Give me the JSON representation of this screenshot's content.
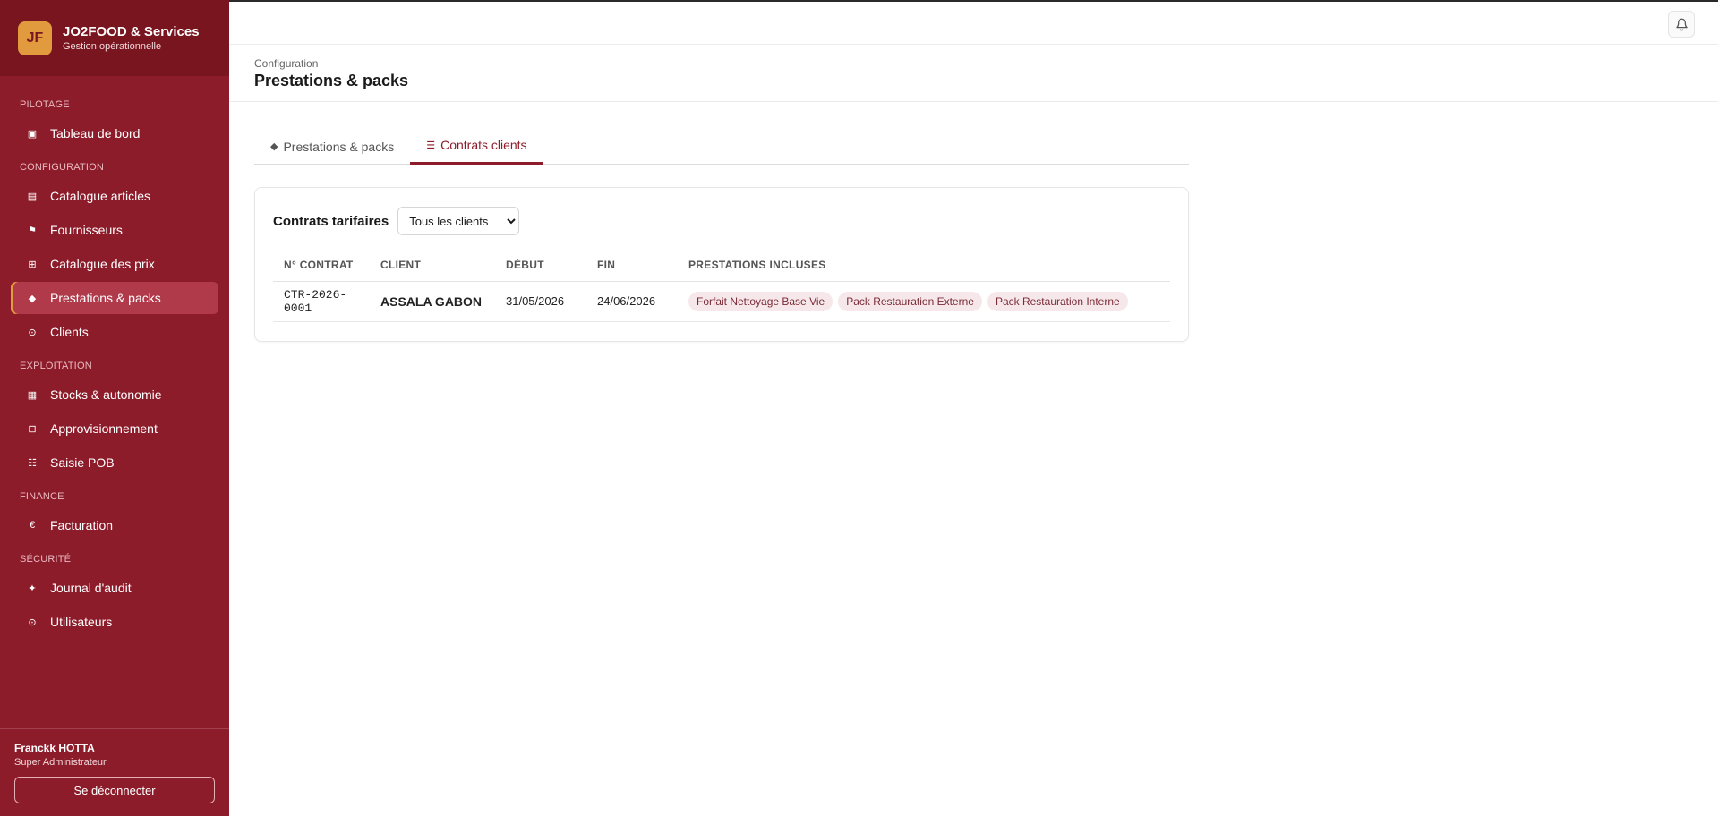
{
  "app": {
    "logo": "JF",
    "name": "JO2FOOD & Services",
    "subtitle": "Gestion opérationnelle"
  },
  "sidebar": {
    "sections": [
      {
        "title": "PILOTAGE",
        "items": [
          {
            "label": "Tableau de bord",
            "icon": "dashboard-icon"
          }
        ]
      },
      {
        "title": "CONFIGURATION",
        "items": [
          {
            "label": "Catalogue articles",
            "icon": "catalog-icon"
          },
          {
            "label": "Fournisseurs",
            "icon": "flag-icon"
          },
          {
            "label": "Catalogue des prix",
            "icon": "grid-icon"
          },
          {
            "label": "Prestations & packs",
            "icon": "diamond-icon",
            "active": true
          },
          {
            "label": "Clients",
            "icon": "circle-icon"
          }
        ]
      },
      {
        "title": "EXPLOITATION",
        "items": [
          {
            "label": "Stocks & autonomie",
            "icon": "stock-icon"
          },
          {
            "label": "Approvisionnement",
            "icon": "supply-icon"
          },
          {
            "label": "Saisie POB",
            "icon": "list-icon"
          }
        ]
      },
      {
        "title": "FINANCE",
        "items": [
          {
            "label": "Facturation",
            "icon": "euro-icon"
          }
        ]
      },
      {
        "title": "SÉCURITÉ",
        "items": [
          {
            "label": "Journal d'audit",
            "icon": "spark-icon"
          },
          {
            "label": "Utilisateurs",
            "icon": "user-circle-icon"
          }
        ]
      }
    ]
  },
  "user": {
    "name": "Franckk HOTTA",
    "role": "Super Administrateur",
    "logout_label": "Se déconnecter"
  },
  "header": {
    "breadcrumb": "Configuration",
    "title": "Prestations & packs"
  },
  "tabs": [
    {
      "label": "Prestations & packs",
      "icon": "◆",
      "active": false
    },
    {
      "label": "Contrats clients",
      "icon": "☰",
      "active": true
    }
  ],
  "card": {
    "title": "Contrats tarifaires",
    "filter_selected": "Tous les clients"
  },
  "table": {
    "columns": [
      "N° CONTRAT",
      "CLIENT",
      "DÉBUT",
      "FIN",
      "PRESTATIONS INCLUSES"
    ],
    "rows": [
      {
        "contract": "CTR-2026-0001",
        "client": "ASSALA GABON",
        "start": "31/05/2026",
        "end": "24/06/2026",
        "tags": [
          "Forfait Nettoyage Base Vie",
          "Pack Restauration Externe",
          "Pack Restauration Interne"
        ]
      }
    ]
  },
  "colors": {
    "sidebar": "#8d1c2b",
    "brand_bar": "#78151f",
    "accent": "#e19a3d",
    "tag_bg": "#f6e8ea"
  }
}
